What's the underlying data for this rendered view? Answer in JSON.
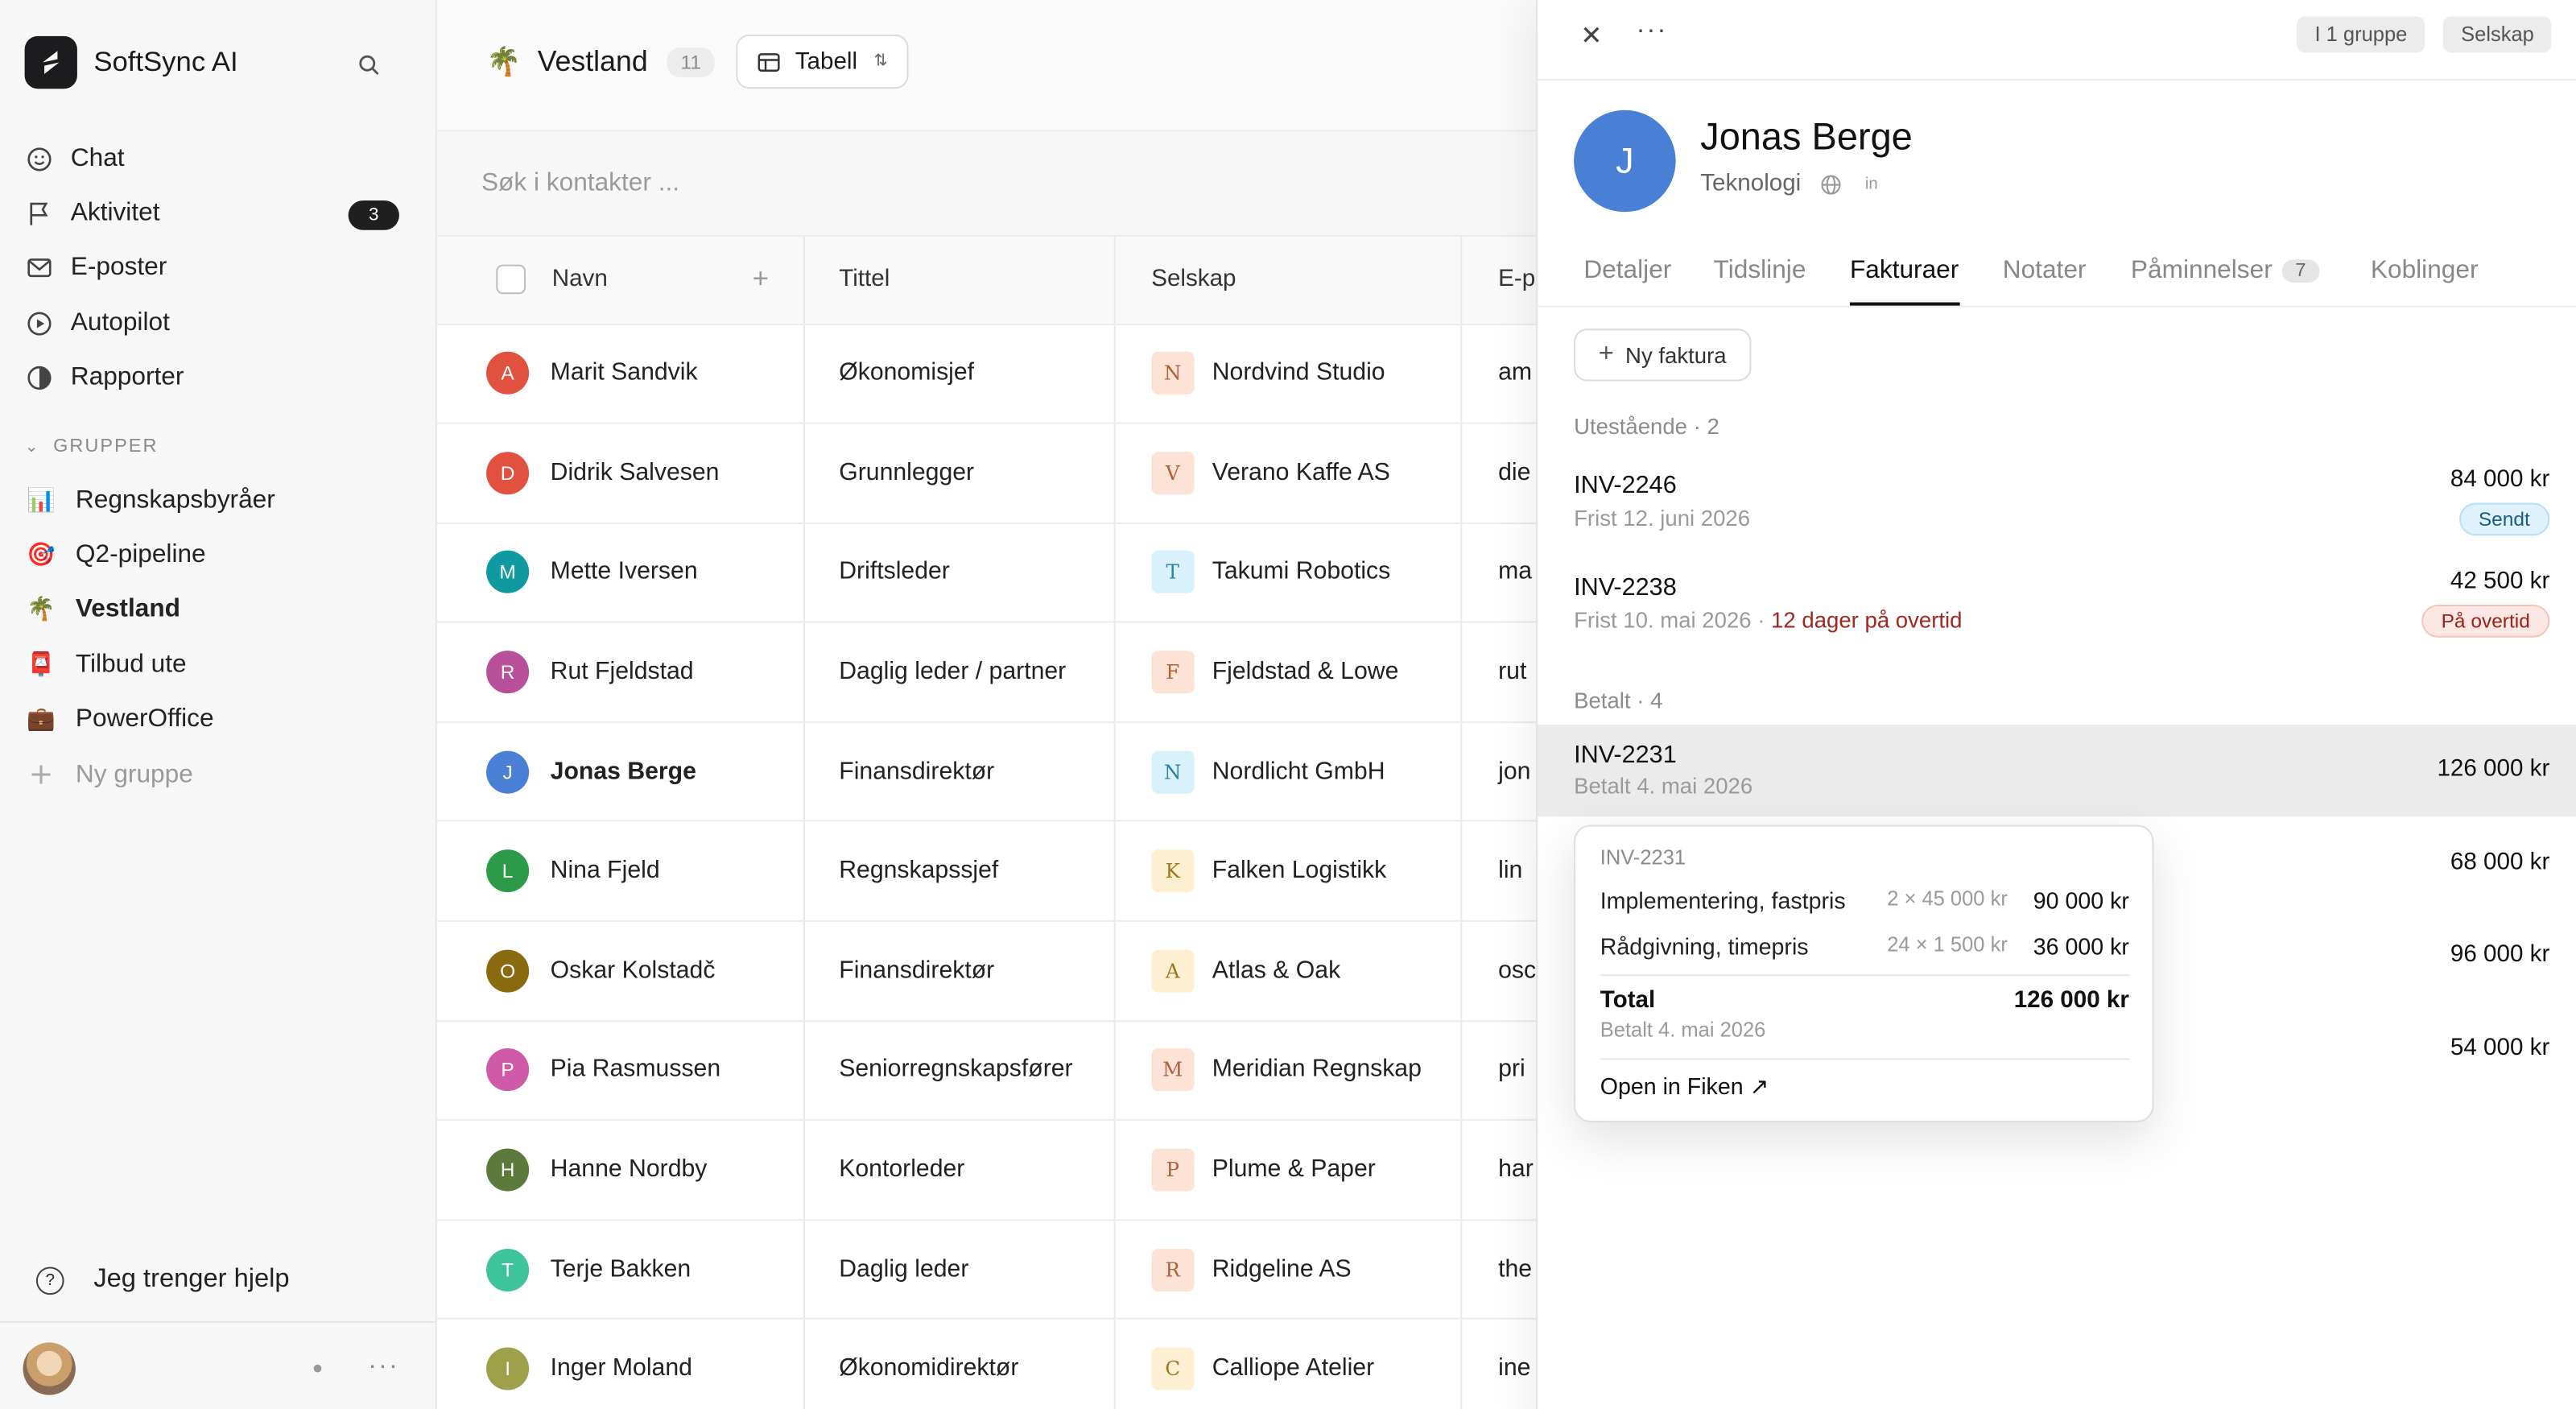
{
  "app": {
    "name": "SoftSync AI"
  },
  "nav": [
    {
      "label": "Chat",
      "icon": "smile-icon"
    },
    {
      "label": "Aktivitet",
      "icon": "flag-icon",
      "badge": "3"
    },
    {
      "label": "E-poster",
      "icon": "mail-icon"
    },
    {
      "label": "Autopilot",
      "icon": "play-circle-icon"
    },
    {
      "label": "Rapporter",
      "icon": "pie-icon"
    }
  ],
  "groups_header": "GRUPPER",
  "groups": [
    {
      "emoji": "📊",
      "label": "Regnskapsbyråer"
    },
    {
      "emoji": "🎯",
      "label": "Q2-pipeline"
    },
    {
      "emoji": "🌴",
      "label": "Vestland"
    },
    {
      "emoji": "📮",
      "label": "Tilbud ute"
    },
    {
      "emoji": "💼",
      "label": "PowerOffice"
    },
    {
      "emoji": "+",
      "label": "Ny gruppe"
    }
  ],
  "help": "Jeg trenger hjelp",
  "view": {
    "emoji": "🌴",
    "title": "Vestland",
    "count": "11",
    "view_mode": "Tabell"
  },
  "search": {
    "placeholder": "Søk i kontakter ..."
  },
  "table": {
    "headers": [
      "Navn",
      "Tittel",
      "Selskap",
      "E-p"
    ],
    "rows": [
      {
        "initial": "A",
        "color": "#e0513f",
        "name": "Marit Sandvik",
        "title": "Økonomisjef",
        "cinit": "N",
        "cbg": "#fde3d6",
        "cfg": "#b0603c",
        "company": "Nordvind Studio",
        "email": "am"
      },
      {
        "initial": "D",
        "color": "#e2503f",
        "name": "Didrik Salvesen",
        "title": "Grunnlegger",
        "cinit": "V",
        "cbg": "#fde3d6",
        "cfg": "#b0603c",
        "company": "Verano Kaffe AS",
        "email": "die"
      },
      {
        "initial": "M",
        "color": "#0e9aa0",
        "name": "Mette Iversen",
        "title": "Driftsleder",
        "cinit": "T",
        "cbg": "#d8f1fb",
        "cfg": "#2a7fa3",
        "company": "Takumi Robotics",
        "email": "ma"
      },
      {
        "initial": "R",
        "color": "#b8519a",
        "name": "Rut Fjeldstad",
        "title": "Daglig leder / partner",
        "cinit": "F",
        "cbg": "#fde3d6",
        "cfg": "#b0603c",
        "company": "Fjeldstad & Lowe",
        "email": "rut"
      },
      {
        "initial": "J",
        "color": "#4a7fd6",
        "name": "Jonas Berge",
        "title": "Finansdirektør",
        "cinit": "N",
        "cbg": "#d8f1fb",
        "cfg": "#2a7fa3",
        "company": "Nordlicht GmbH",
        "email": "jon"
      },
      {
        "initial": "L",
        "color": "#2d9a4a",
        "name": "Nina Fjeld",
        "title": "Regnskapssjef",
        "cinit": "K",
        "cbg": "#fdf0d2",
        "cfg": "#a27420",
        "company": "Falken Logistikk",
        "email": "lin"
      },
      {
        "initial": "O",
        "color": "#8a6a0f",
        "name": "Oskar Kolstadč",
        "title": "Finansdirektør",
        "cinit": "A",
        "cbg": "#fdf0d2",
        "cfg": "#a27420",
        "company": "Atlas & Oak",
        "email": "osc"
      },
      {
        "initial": "P",
        "color": "#cf5aa8",
        "name": "Pia Rasmussen",
        "title": "Seniorregnskapsfører",
        "cinit": "M",
        "cbg": "#fde3d6",
        "cfg": "#b0603c",
        "company": "Meridian Regnskap",
        "email": "pri"
      },
      {
        "initial": "H",
        "color": "#5c7a3c",
        "name": "Hanne Nordby",
        "title": "Kontorleder",
        "cinit": "P",
        "cbg": "#fde3d6",
        "cfg": "#b0603c",
        "company": "Plume & Paper",
        "email": "har"
      },
      {
        "initial": "T",
        "color": "#3ec39a",
        "name": "Terje Bakken",
        "title": "Daglig leder",
        "cinit": "R",
        "cbg": "#fde3d6",
        "cfg": "#b0603c",
        "company": "Ridgeline AS",
        "email": "the"
      },
      {
        "initial": "I",
        "color": "#9ea04a",
        "name": "Inger Moland",
        "title": "Økonomidirektør",
        "cinit": "C",
        "cbg": "#fdf0d2",
        "cfg": "#a27420",
        "company": "Calliope Atelier",
        "email": "ine"
      }
    ]
  },
  "panel": {
    "tag_groups": "I 1 gruppe",
    "tag_company": "Selskap",
    "initial": "J",
    "name": "Jonas Berge",
    "industry": "Teknologi",
    "linkedin": "in",
    "tabs": [
      "Detaljer",
      "Tidslinje",
      "Fakturaer",
      "Notater",
      "Påminnelser",
      "Koblinger"
    ],
    "reminders_count": "7",
    "new_invoice": "Ny faktura",
    "outstanding_label": "Utestående",
    "outstanding_count": "· 2",
    "paid_label": "Betalt",
    "paid_count": "· 4",
    "outstanding": [
      {
        "id": "INV-2246",
        "due": "Frist 12. juni 2026",
        "overdue": "",
        "amount": "84 000 kr",
        "status": "Sendt"
      },
      {
        "id": "INV-2238",
        "due": "Frist 10. mai 2026 · ",
        "overdue": "12 dager på overtid",
        "amount": "42 500 kr",
        "status": "På overtid"
      }
    ],
    "paid": [
      {
        "id": "INV-2231",
        "meta": "Betalt 4. mai 2026",
        "amount": "126 000 kr"
      },
      {
        "amount": "68 000 kr"
      },
      {
        "amount": "96 000 kr"
      },
      {
        "amount": "54 000 kr"
      }
    ]
  },
  "tooltip": {
    "id": "INV-2231",
    "lines": [
      {
        "desc": "Implementering, fastpris",
        "qty": "2 × 45 000 kr",
        "value": "90 000 kr"
      },
      {
        "desc": "Rådgivning, timepris",
        "qty": "24 × 1 500 kr",
        "value": "36 000 kr"
      }
    ],
    "total_label": "Total",
    "total": "126 000 kr",
    "paid": "Betalt 4. mai 2026",
    "open": "Open in Fiken ↗"
  }
}
